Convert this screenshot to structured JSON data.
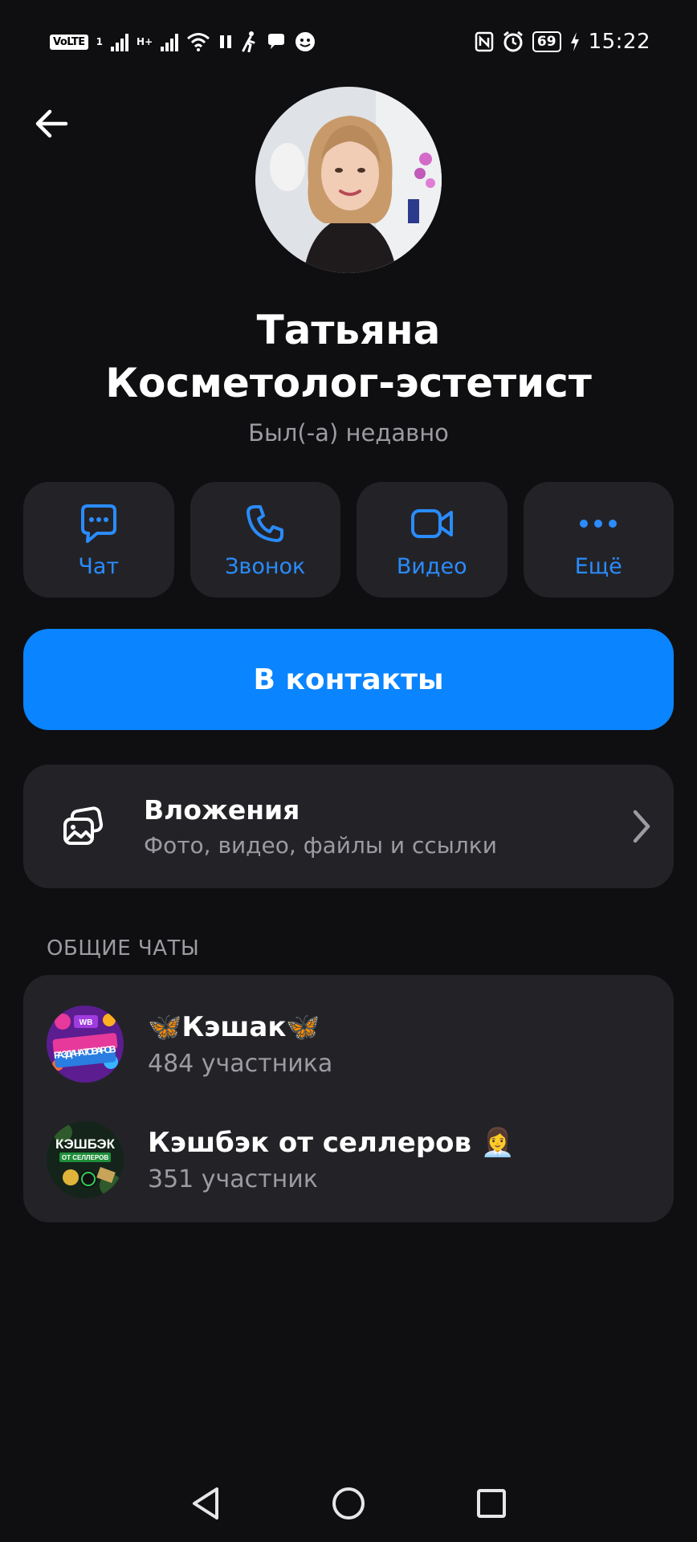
{
  "status_bar": {
    "volte": "VoLTE",
    "sim1": "1",
    "network": "H+",
    "time": "15:22",
    "battery": "69",
    "icons": [
      "signal-icon",
      "wifi-icon",
      "pause-icon",
      "walk-icon",
      "chat-bubble-icon",
      "face-icon",
      "nfc-icon",
      "alarm-icon",
      "charging-icon"
    ]
  },
  "profile": {
    "name_line1": "Татьяна",
    "name_line2": "Косметолог-эстетист",
    "status": "Был(-а) недавно"
  },
  "actions": [
    {
      "label": "Чат",
      "icon": "chat-icon"
    },
    {
      "label": "Звонок",
      "icon": "phone-icon"
    },
    {
      "label": "Видео",
      "icon": "video-icon"
    },
    {
      "label": "Ещё",
      "icon": "more-icon"
    }
  ],
  "add_contact_label": "В контакты",
  "attachments": {
    "title": "Вложения",
    "subtitle": "Фото, видео, файлы и ссылки"
  },
  "common_chats": {
    "section_title": "ОБЩИЕ ЧАТЫ",
    "items": [
      {
        "title": "🦋Кэшак🦋",
        "members": "484 участника",
        "avatar_text": "РАЗДАЧА ТОВАРОВ",
        "avatar_badge": "WB"
      },
      {
        "title": "Кэшбэк от селлеров 👩‍💼",
        "members": "351 участник",
        "avatar_text": "КЭШБЭК",
        "avatar_sub": "ОТ СЕЛЛЕРОВ"
      }
    ]
  },
  "colors": {
    "background": "#0f0f11",
    "card": "#232327",
    "accent": "#0a84ff",
    "secondary_text": "#9b9ba1"
  }
}
